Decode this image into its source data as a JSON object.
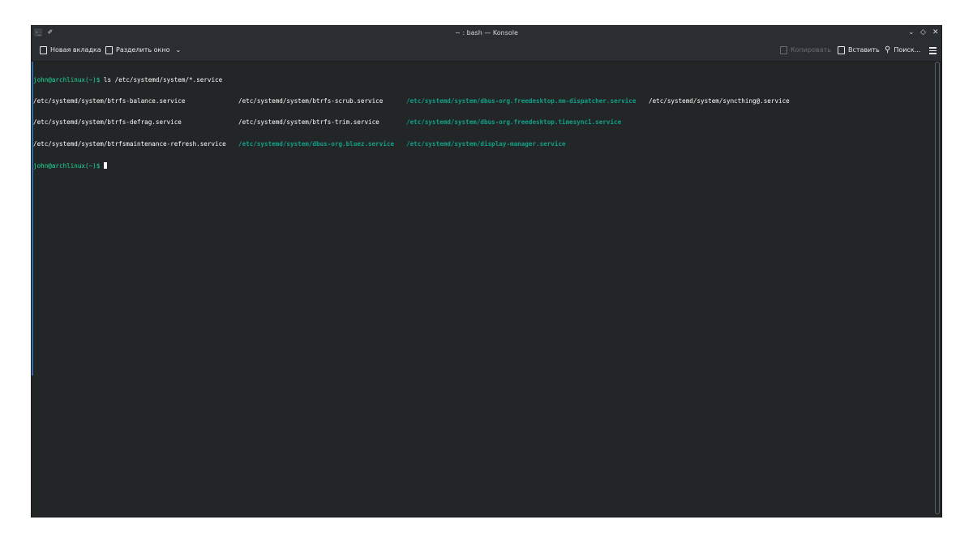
{
  "window": {
    "title": "~ : bash — Konsole"
  },
  "titlebar": {
    "minimize_glyph": "⌄",
    "maximize_glyph": "◇",
    "close_glyph": "✕",
    "pin_glyph": "✐",
    "app_glyph": "›_"
  },
  "toolbar": {
    "new_tab": "Новая вкладка",
    "split_view": "Разделить окно",
    "split_chevron": "⌄",
    "copy": "Копировать",
    "paste": "Вставить",
    "search": "Поиск..."
  },
  "terminal": {
    "prompt": "john@archlinux(~)$",
    "command": " ls /etc/systemd/system/*.service",
    "row1": [
      "/etc/systemd/system/btrfs-balance.service",
      "/etc/systemd/system/btrfs-scrub.service",
      "/etc/systemd/system/dbus-org.freedesktop.nm-dispatcher.service",
      "/etc/systemd/system/syncthing@.service"
    ],
    "row2": [
      "/etc/systemd/system/btrfs-defrag.service",
      "/etc/systemd/system/btrfs-trim.service",
      "/etc/systemd/system/dbus-org.freedesktop.timesync1.service"
    ],
    "row3": [
      "/etc/systemd/system/btrfsmaintenance-refresh.service",
      "/etc/systemd/system/dbus-org.bluez.service",
      "/etc/systemd/system/display-manager.service"
    ],
    "prompt2": "john@archlinux(~)$"
  },
  "colors": {
    "background": "#232627",
    "prompt": "#1cdc9a",
    "symlink": "#11a088",
    "text": "#fcfcfc"
  }
}
